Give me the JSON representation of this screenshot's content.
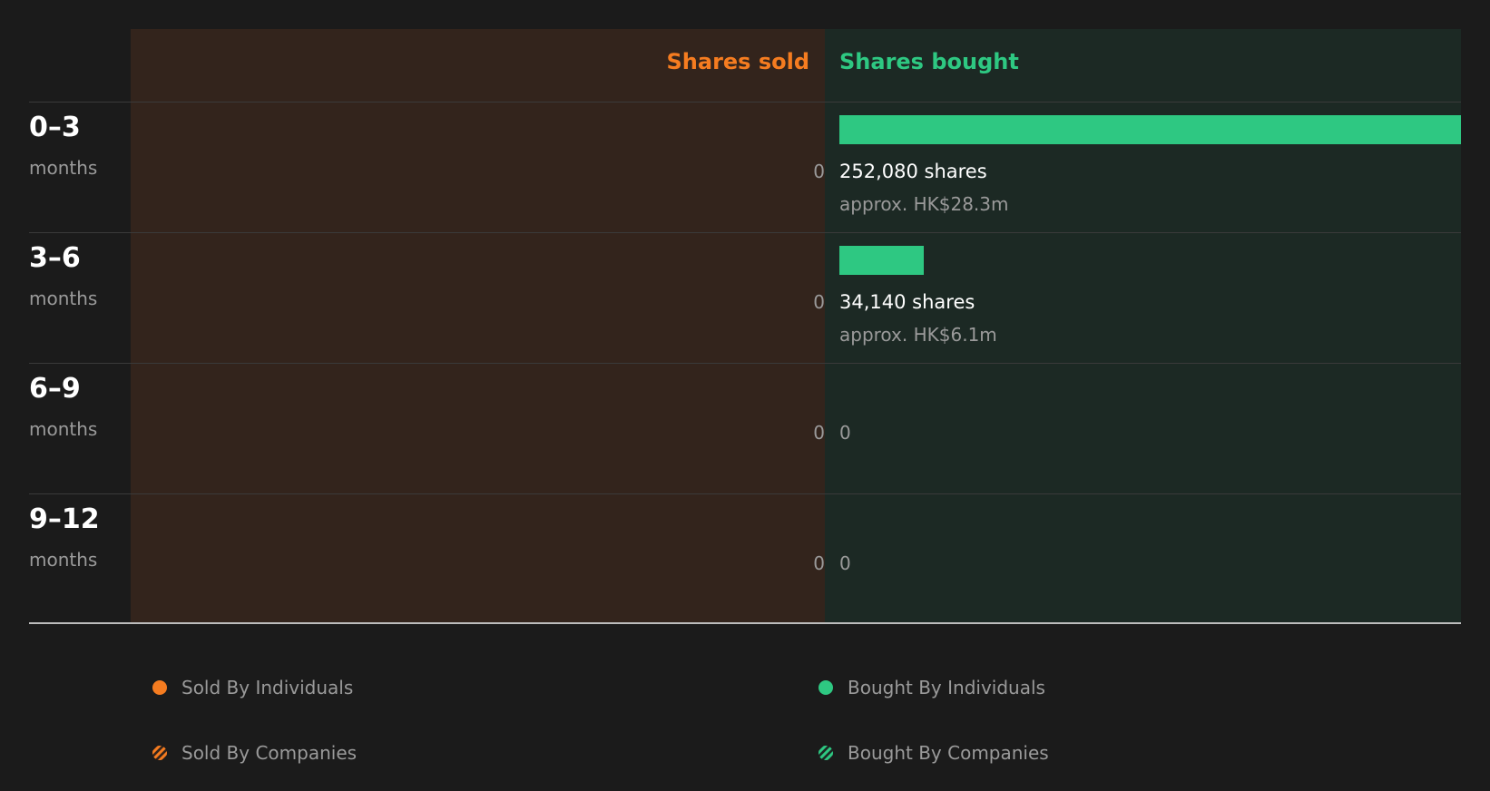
{
  "colors": {
    "sold": "#f57c20",
    "bought": "#2ec882"
  },
  "header": {
    "sold": "Shares sold",
    "bought": "Shares bought"
  },
  "chart_data": {
    "type": "bar",
    "categories": [
      "0-3 months",
      "3-6 months",
      "6-9 months",
      "9-12 months"
    ],
    "series": [
      {
        "name": "Shares sold",
        "values": [
          0,
          0,
          0,
          0
        ]
      },
      {
        "name": "Shares bought",
        "values": [
          252080,
          34140,
          0,
          0
        ]
      }
    ]
  },
  "rows": [
    {
      "period": "0–3",
      "unit": "months",
      "sold": "0",
      "bought_shares": "252,080 shares",
      "bought_approx": "approx. HK$28.3m"
    },
    {
      "period": "3–6",
      "unit": "months",
      "sold": "0",
      "bought_shares": "34,140 shares",
      "bought_approx": "approx. HK$6.1m"
    },
    {
      "period": "6–9",
      "unit": "months",
      "sold": "0",
      "bought_zero": "0"
    },
    {
      "period": "9–12",
      "unit": "months",
      "sold": "0",
      "bought_zero": "0"
    }
  ],
  "legend": {
    "sold_individuals": "Sold By Individuals",
    "sold_companies": "Sold By Companies",
    "bought_individuals": "Bought By Individuals",
    "bought_companies": "Bought By Companies"
  }
}
